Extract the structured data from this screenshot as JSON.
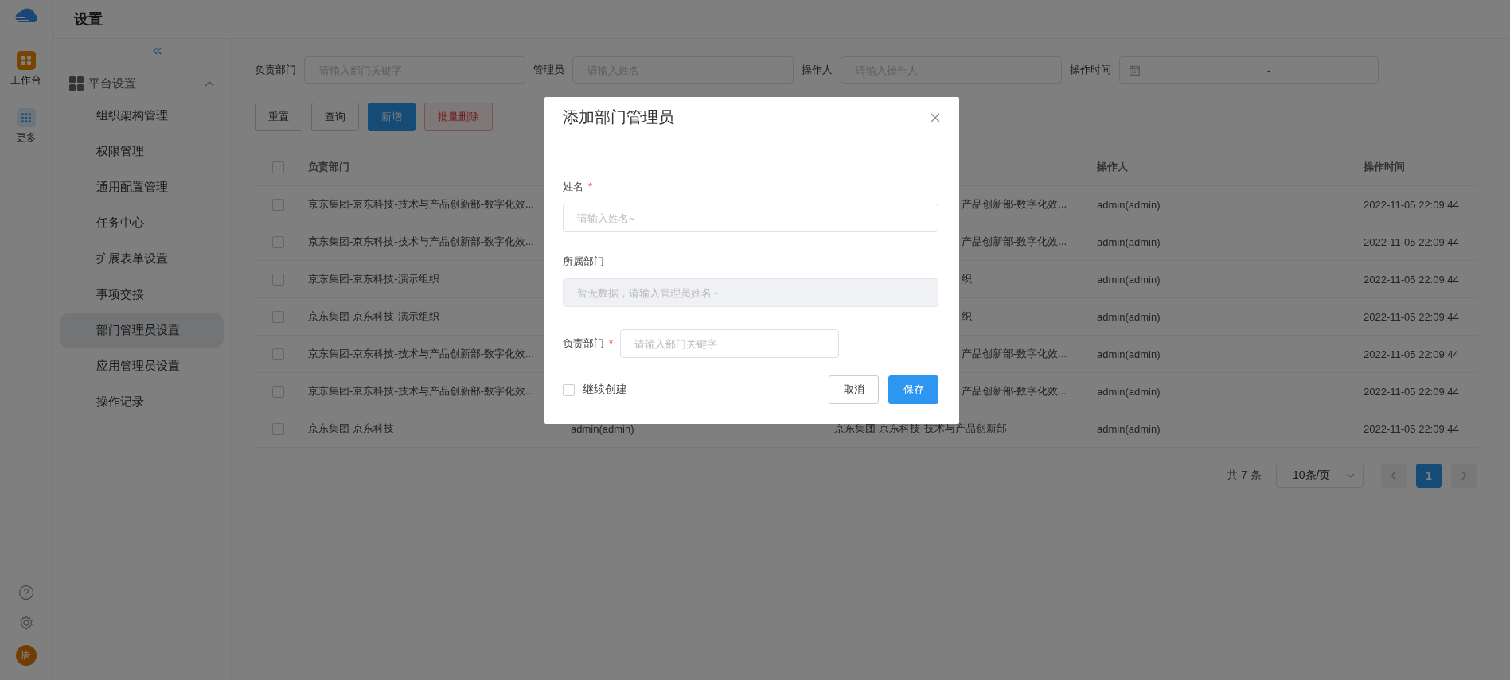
{
  "rail": {
    "items": [
      {
        "label": "工作台",
        "kind": "apps"
      },
      {
        "label": "更多",
        "kind": "more"
      }
    ],
    "avatar": "唐"
  },
  "header": {
    "title": "设置"
  },
  "sidebar": {
    "group": {
      "label": "平台设置",
      "expanded": true,
      "children": [
        {
          "label": "组织架构管理",
          "selected": false
        },
        {
          "label": "权限管理",
          "selected": false
        },
        {
          "label": "通用配置管理",
          "selected": false
        },
        {
          "label": "任务中心",
          "selected": false
        },
        {
          "label": "扩展表单设置",
          "selected": false
        },
        {
          "label": "事项交接",
          "selected": false
        },
        {
          "label": "部门管理员设置",
          "selected": true
        },
        {
          "label": "应用管理员设置",
          "selected": false
        },
        {
          "label": "操作记录",
          "selected": false
        }
      ]
    }
  },
  "filters": [
    {
      "label": "负责部门",
      "placeholder": "请输入部门关键字",
      "kind": "text"
    },
    {
      "label": "管理员",
      "placeholder": "请输入姓名",
      "kind": "text"
    },
    {
      "label": "操作人",
      "placeholder": "请输入操作人",
      "kind": "text"
    },
    {
      "label": "操作时间",
      "separator": "-",
      "kind": "daterange"
    }
  ],
  "actions": [
    {
      "label": "重置",
      "kind": "default"
    },
    {
      "label": "查询",
      "kind": "default"
    },
    {
      "label": "新增",
      "kind": "primary"
    },
    {
      "label": "批量删除",
      "kind": "danger"
    }
  ],
  "table": {
    "all_checked": false,
    "columns": [
      {
        "label": "负责部门"
      },
      {},
      {},
      {
        "label": "操作人"
      },
      {
        "label": "操作时间"
      }
    ],
    "rows": [
      {
        "checked": false,
        "cells": [
          "京东集团-京东科技-技术与产品创新部-数字化效...",
          "",
          "产品创新部-数字化效...",
          "admin(admin)",
          "2022-11-05 22:09:44"
        ]
      },
      {
        "checked": false,
        "cells": [
          "京东集团-京东科技-技术与产品创新部-数字化效...",
          "",
          "产品创新部-数字化效...",
          "admin(admin)",
          "2022-11-05 22:09:44"
        ]
      },
      {
        "checked": false,
        "cells": [
          "京东集团-京东科技-演示组织",
          "",
          "织",
          "admin(admin)",
          "2022-11-05 22:09:44"
        ]
      },
      {
        "checked": false,
        "cells": [
          "京东集团-京东科技-演示组织",
          "",
          "织",
          "admin(admin)",
          "2022-11-05 22:09:44"
        ]
      },
      {
        "checked": false,
        "cells": [
          "京东集团-京东科技-技术与产品创新部-数字化效...",
          "",
          "产品创新部-数字化效...",
          "admin(admin)",
          "2022-11-05 22:09:44"
        ]
      },
      {
        "checked": false,
        "cells": [
          "京东集团-京东科技-技术与产品创新部-数字化效...",
          "",
          "产品创新部-数字化效...",
          "admin(admin)",
          "2022-11-05 22:09:44"
        ]
      },
      {
        "checked": false,
        "cells": [
          "京东集团-京东科技",
          "admin(admin)",
          "京东集团-京东科技-技术与产品创新部",
          "admin(admin)",
          "2022-11-05 22:09:44"
        ]
      }
    ]
  },
  "pagination": {
    "total": "共 7 条",
    "page_size": "10条/页",
    "pages": [
      {
        "label": "1",
        "selected": true
      }
    ]
  },
  "dialog": {
    "title": "添加部门管理员",
    "fields": [
      {
        "label": "姓名",
        "required_mark": "*",
        "placeholder": "请输入姓名~",
        "disabled": false,
        "kind": "stacked"
      },
      {
        "label": "所属部门",
        "placeholder": "暂无数据，请输入管理员姓名~",
        "disabled": true,
        "kind": "stacked"
      },
      {
        "label": "负责部门",
        "required_mark": "*",
        "placeholder": "请输入部门关键字",
        "disabled": false,
        "kind": "inline"
      }
    ],
    "continue": {
      "label": "继续创建",
      "checked": false
    },
    "buttons": [
      {
        "label": "取消",
        "kind": "default"
      },
      {
        "label": "保存",
        "kind": "primary"
      }
    ]
  }
}
